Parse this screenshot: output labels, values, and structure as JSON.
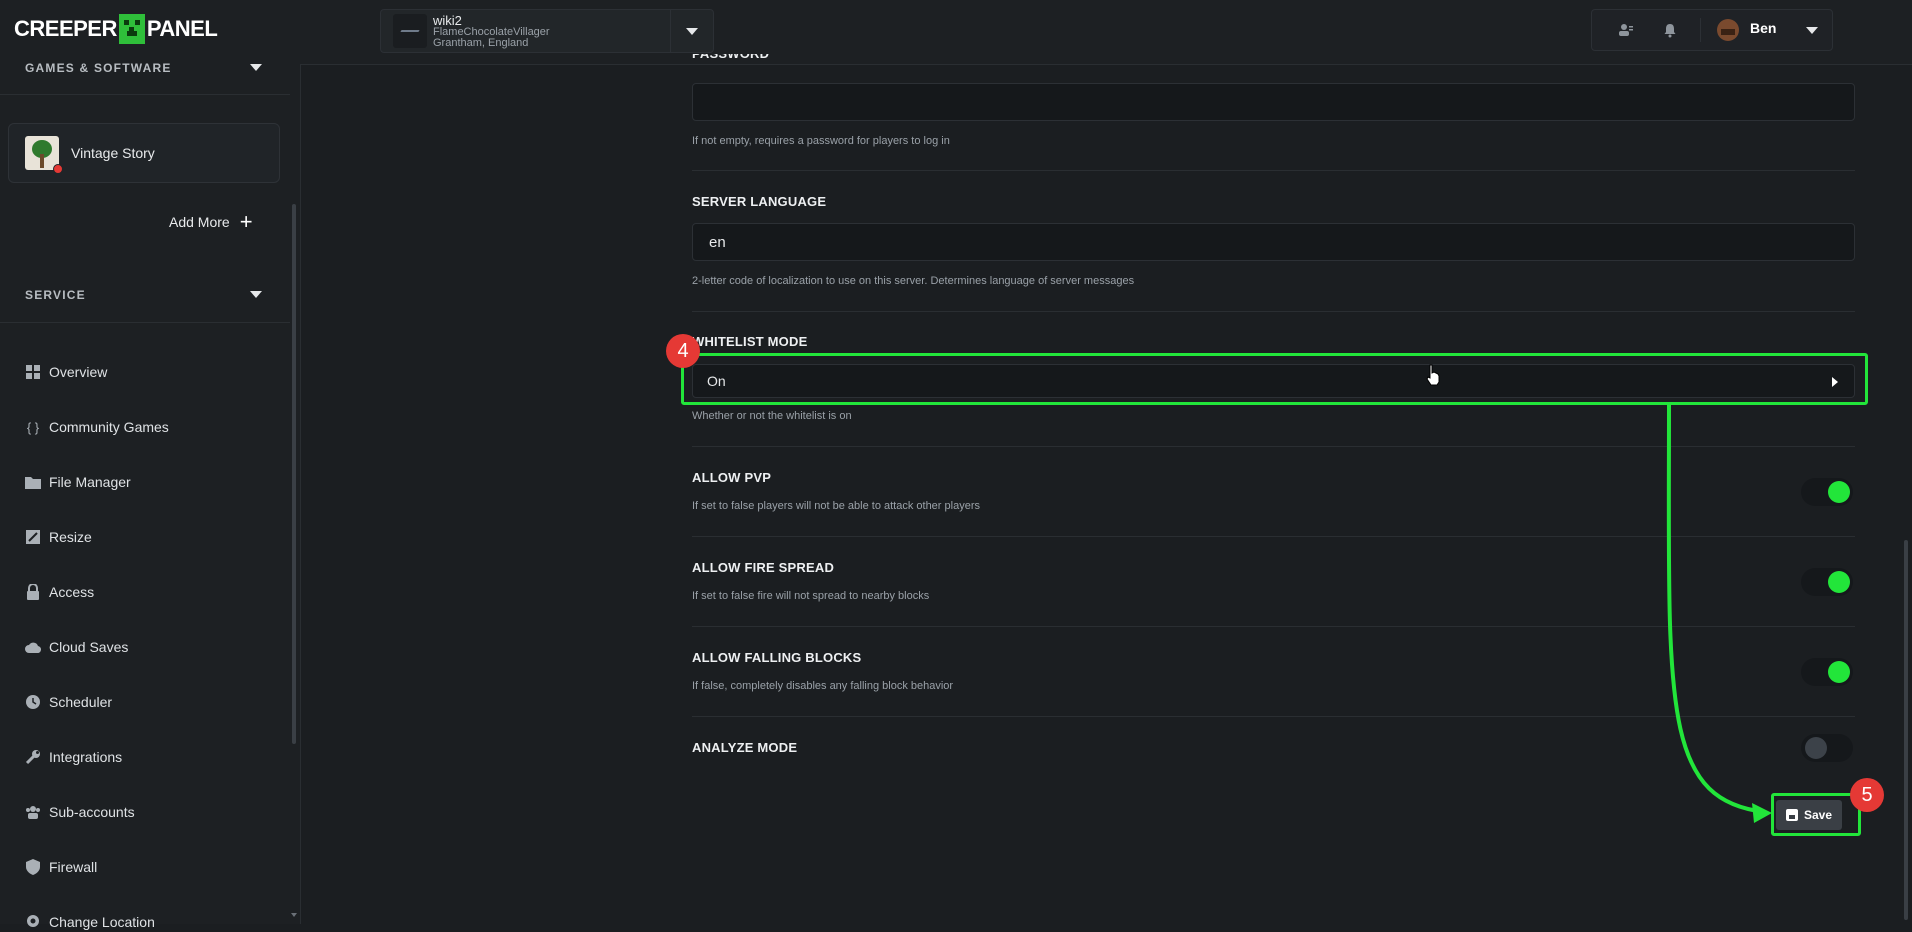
{
  "app": {
    "logo_text_left": "CREEPER",
    "logo_text_right": "PANEL"
  },
  "server_picker": {
    "name": "wiki2",
    "node": "FlameChocolateVillager",
    "location": "Grantham, England"
  },
  "user": {
    "name": "Ben"
  },
  "sidebar": {
    "games_header": "GAMES & SOFTWARE",
    "game": {
      "name": "Vintage Story"
    },
    "add_more": "Add More",
    "service_header": "SERVICE",
    "items": [
      {
        "label": "Overview",
        "icon": "grid-icon"
      },
      {
        "label": "Community Games",
        "icon": "braces-icon"
      },
      {
        "label": "File Manager",
        "icon": "folder-icon"
      },
      {
        "label": "Resize",
        "icon": "resize-icon"
      },
      {
        "label": "Access",
        "icon": "lock-icon"
      },
      {
        "label": "Cloud Saves",
        "icon": "cloud-icon"
      },
      {
        "label": "Scheduler",
        "icon": "clock-icon"
      },
      {
        "label": "Integrations",
        "icon": "wrench-icon"
      },
      {
        "label": "Sub-accounts",
        "icon": "users-icon"
      },
      {
        "label": "Firewall",
        "icon": "shield-icon"
      },
      {
        "label": "Change Location",
        "icon": "location-icon"
      }
    ]
  },
  "settings": {
    "password": {
      "label": "PASSWORD",
      "value": "",
      "help": "If not empty, requires a password for players to log in"
    },
    "server_language": {
      "label": "SERVER LANGUAGE",
      "value": "en",
      "help": "2-letter code of localization to use on this server. Determines language of server messages"
    },
    "whitelist_mode": {
      "label": "WHITELIST MODE",
      "value": "On",
      "help": "Whether or not the whitelist is on"
    },
    "allow_pvp": {
      "label": "ALLOW PVP",
      "help": "If set to false players will not be able to attack other players",
      "enabled": true
    },
    "allow_fire_spread": {
      "label": "ALLOW FIRE SPREAD",
      "help": "If set to false fire will not spread to nearby blocks",
      "enabled": true
    },
    "allow_falling_blocks": {
      "label": "ALLOW FALLING BLOCKS",
      "help": "If false, completely disables any falling block behavior",
      "enabled": true
    },
    "analyze_mode": {
      "label": "ANALYZE MODE",
      "enabled": false
    }
  },
  "save_label": "Save",
  "annotations": {
    "step_4": "4",
    "step_5": "5"
  },
  "colors": {
    "accent": "#22e53a",
    "badge": "#e53935",
    "background": "#1b1e21"
  }
}
